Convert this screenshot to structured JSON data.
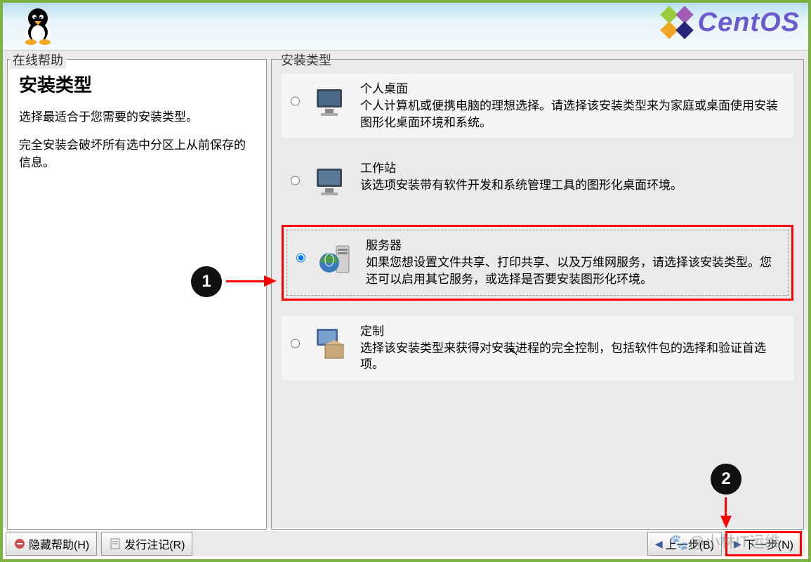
{
  "header": {
    "brand": "CentOS"
  },
  "help": {
    "legend": "在线帮助",
    "title": "安装类型",
    "p1": "选择最适合于您需要的安装类型。",
    "p2": "完全安装会破坏所有选中分区上从前保存的信息。"
  },
  "content": {
    "legend": "安装类型",
    "options": [
      {
        "title": "个人桌面",
        "desc": "个人计算机或便携电脑的理想选择。请选择该安装类型来为家庭或桌面使用安装图形化桌面环境和系统。"
      },
      {
        "title": "工作站",
        "desc": "该选项安装带有软件开发和系统管理工具的图形化桌面环境。"
      },
      {
        "title": "服务器",
        "desc": "如果您想设置文件共享、打印共享、以及万维网服务，请选择该安装类型。您还可以启用其它服务，或选择是否要安装图形化环境。"
      },
      {
        "title": "定制",
        "desc": "选择该安装类型来获得对安装进程的完全控制，包括软件包的选择和验证首选项。"
      }
    ]
  },
  "footer": {
    "hide_help": "隐藏帮助(H)",
    "release_notes": "发行注记(R)",
    "back": "上一步(B)",
    "next": "下一步(N)"
  },
  "annotations": {
    "badge1": "1",
    "badge2": "2"
  },
  "watermark": "🐾@小林IT运维"
}
